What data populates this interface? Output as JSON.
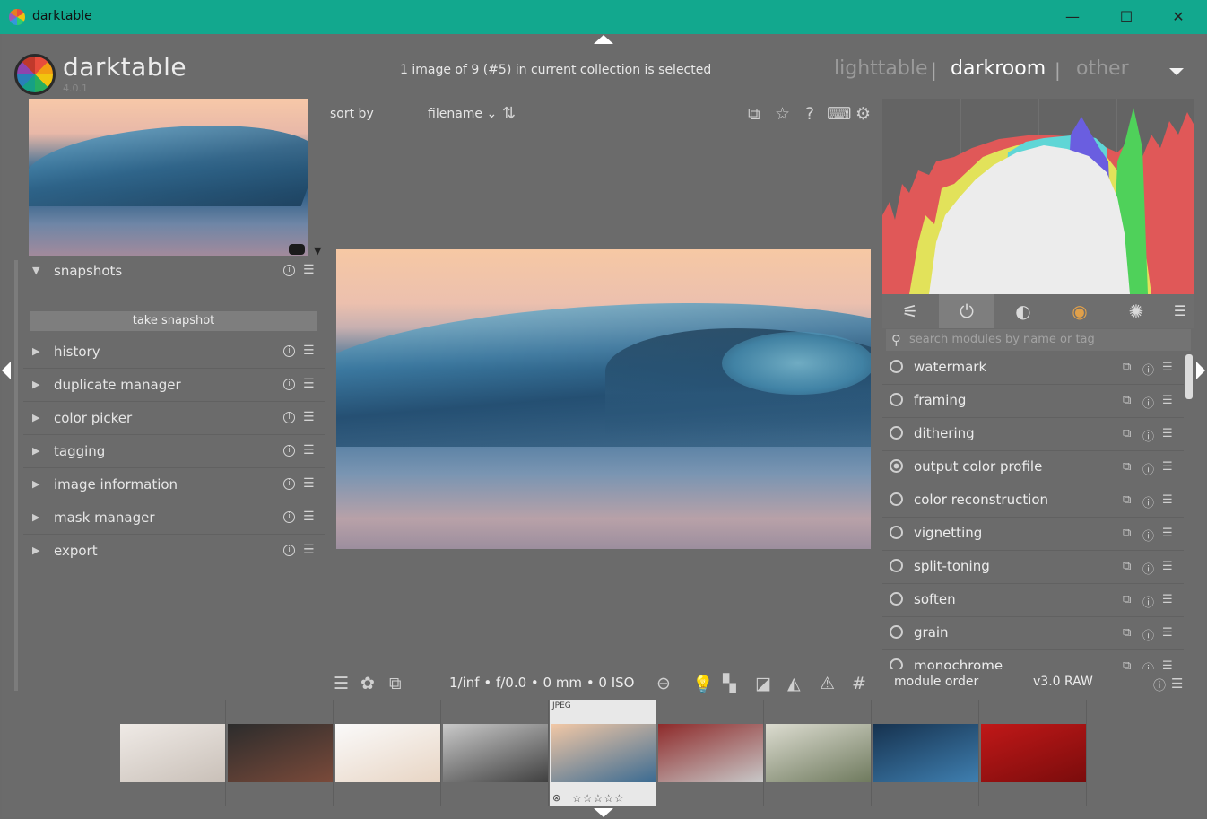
{
  "window": {
    "title": "darktable",
    "controls": {
      "minimize": "—",
      "maximize": "☐",
      "close": "✕"
    }
  },
  "header": {
    "brand": "darktable",
    "version": "4.0.1",
    "collection_status": "1 image of 9 (#5) in current collection is selected",
    "views": [
      {
        "label": "lighttable",
        "active": false
      },
      {
        "label": "darkroom",
        "active": true
      },
      {
        "label": "other",
        "active": false
      }
    ],
    "view_separator": "|",
    "views_dropdown_icon": "chevron-down-icon"
  },
  "left_panel": {
    "snapshots_label": "snapshots",
    "take_snapshot_label": "take snapshot",
    "modules": [
      {
        "label": "history"
      },
      {
        "label": "duplicate manager"
      },
      {
        "label": "color picker"
      },
      {
        "label": "tagging"
      },
      {
        "label": "image information"
      },
      {
        "label": "mask manager"
      },
      {
        "label": "export"
      }
    ],
    "info_glyph": "i",
    "menu_glyph": "☰",
    "expand_glyph": "▶",
    "collapse_glyph": "▼"
  },
  "center": {
    "sort_label": "sort by",
    "sort_value": "filename ⌄",
    "exif_summary": "1/inf • f/0.0 • 0 mm • 0 ISO",
    "module_order_label": "module order",
    "module_order_value": "v3.0 RAW"
  },
  "right_panel": {
    "search_placeholder": "search modules by name or tag",
    "modules": [
      {
        "label": "watermark",
        "enabled": false
      },
      {
        "label": "framing",
        "enabled": false
      },
      {
        "label": "dithering",
        "enabled": false
      },
      {
        "label": "output color profile",
        "enabled": true
      },
      {
        "label": "color reconstruction",
        "enabled": false
      },
      {
        "label": "vignetting",
        "enabled": false
      },
      {
        "label": "split-toning",
        "enabled": false
      },
      {
        "label": "soften",
        "enabled": false
      },
      {
        "label": "grain",
        "enabled": false
      },
      {
        "label": "monochrome",
        "enabled": false
      }
    ]
  },
  "filmstrip": {
    "selected_index": 4,
    "thumbnails": [
      {
        "name": "headphones",
        "colors": [
          "#efeae6",
          "#c9c0b8"
        ],
        "ext": ""
      },
      {
        "name": "desk-setup",
        "colors": [
          "#2c2c2c",
          "#7a4a3a"
        ],
        "ext": ""
      },
      {
        "name": "iphone",
        "colors": [
          "#fafafa",
          "#e8d5c4"
        ],
        "ext": ""
      },
      {
        "name": "linux-cube",
        "colors": [
          "#c9c9c9",
          "#404040"
        ],
        "ext": ""
      },
      {
        "name": "wave",
        "colors": [
          "#f2c8a6",
          "#3b6b92"
        ],
        "ext": "JPEG"
      },
      {
        "name": "hard-drive",
        "colors": [
          "#8e2a2a",
          "#c8c8c8"
        ],
        "ext": ""
      },
      {
        "name": "chain-fence",
        "colors": [
          "#dcdcd0",
          "#6f7a5e"
        ],
        "ext": ""
      },
      {
        "name": "bokeh",
        "colors": [
          "#16324f",
          "#3f7fb0"
        ],
        "ext": ""
      },
      {
        "name": "youtube",
        "colors": [
          "#c01818",
          "#7a0c0c"
        ],
        "ext": ""
      }
    ],
    "stars": "☆☆☆☆☆",
    "reject_glyph": "⊗"
  },
  "colors": {
    "titlebar": "#12a88e",
    "panel": "#6b6b6b",
    "histogram_red": "#e05858",
    "histogram_yellow": "#e2e25a",
    "histogram_green": "#4fd15a",
    "histogram_blue": "#6a5ee0",
    "histogram_cyan": "#5fd6d6",
    "histogram_white": "#ececec"
  }
}
